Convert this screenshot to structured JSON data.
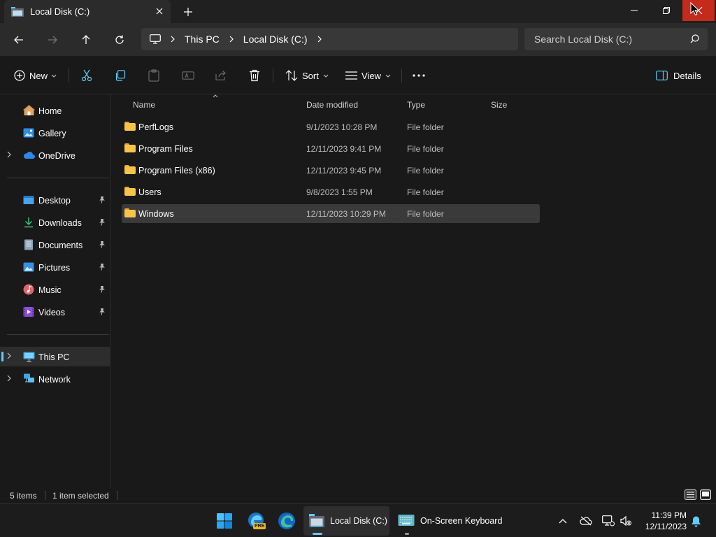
{
  "window": {
    "tab_title": "Local Disk (C:)"
  },
  "address": {
    "crumbs": [
      "This PC",
      "Local Disk (C:)"
    ],
    "search_placeholder": "Search Local Disk (C:)"
  },
  "toolbar": {
    "new_label": "New",
    "sort_label": "Sort",
    "view_label": "View",
    "details_label": "Details"
  },
  "sidebar": {
    "items": [
      {
        "label": "Home",
        "icon": "home-icon"
      },
      {
        "label": "Gallery",
        "icon": "gallery-icon"
      },
      {
        "label": "OneDrive",
        "icon": "cloud-icon"
      },
      {
        "label": "Desktop",
        "icon": "desktop-icon"
      },
      {
        "label": "Downloads",
        "icon": "download-icon"
      },
      {
        "label": "Documents",
        "icon": "documents-icon"
      },
      {
        "label": "Pictures",
        "icon": "pictures-icon"
      },
      {
        "label": "Music",
        "icon": "music-icon"
      },
      {
        "label": "Videos",
        "icon": "videos-icon"
      },
      {
        "label": "This PC",
        "icon": "computer-icon"
      },
      {
        "label": "Network",
        "icon": "network-icon"
      }
    ]
  },
  "columns": {
    "name": "Name",
    "date": "Date modified",
    "type": "Type",
    "size": "Size"
  },
  "files": [
    {
      "name": "PerfLogs",
      "date": "9/1/2023 10:28 PM",
      "type": "File folder"
    },
    {
      "name": "Program Files",
      "date": "12/11/2023 9:41 PM",
      "type": "File folder"
    },
    {
      "name": "Program Files (x86)",
      "date": "12/11/2023 9:45 PM",
      "type": "File folder"
    },
    {
      "name": "Users",
      "date": "9/8/2023 1:55 PM",
      "type": "File folder"
    },
    {
      "name": "Windows",
      "date": "12/11/2023 10:29 PM",
      "type": "File folder"
    }
  ],
  "status": {
    "count": "5 items",
    "selection": "1 item selected"
  },
  "taskbar": {
    "explorer_label": "Local Disk (C:)",
    "keyboard_label": "On-Screen Keyboard",
    "time": "11:39 PM",
    "date": "12/11/2023",
    "edge_badge": "PRE"
  },
  "colors": {
    "accent": "#60cdff",
    "close_red": "#c42b1c",
    "folder": "#f7c34a"
  }
}
